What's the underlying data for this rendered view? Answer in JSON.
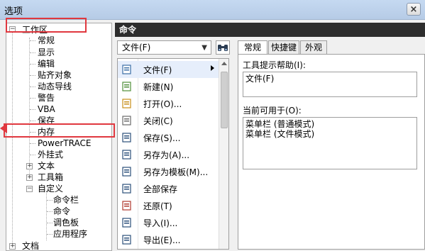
{
  "window": {
    "title": "选项",
    "close_label": "×"
  },
  "tree": {
    "items": [
      {
        "label": "工作区",
        "expander": "−"
      },
      {
        "label": "常规"
      },
      {
        "label": "显示"
      },
      {
        "label": "编辑"
      },
      {
        "label": "贴齐对象"
      },
      {
        "label": "动态导线"
      },
      {
        "label": "警告"
      },
      {
        "label": "VBA"
      },
      {
        "label": "保存"
      },
      {
        "label": "内存"
      },
      {
        "label": "PowerTRACE"
      },
      {
        "label": "外挂式"
      },
      {
        "label": "文本",
        "expander": "+"
      },
      {
        "label": "工具箱",
        "expander": "+"
      },
      {
        "label": "自定义",
        "expander": "−"
      },
      {
        "label": "命令栏"
      },
      {
        "label": "命令"
      },
      {
        "label": "调色板"
      },
      {
        "label": "应用程序"
      },
      {
        "label": "文档",
        "expander": "+"
      }
    ]
  },
  "panel": {
    "header": "命令"
  },
  "category_dropdown": {
    "value": "文件(F)"
  },
  "commands": {
    "items": [
      {
        "label": "文件(F)",
        "icon": "menu-icon",
        "has_submenu": true
      },
      {
        "label": "新建(N)",
        "icon": "new-doc-icon"
      },
      {
        "label": "打开(O)...",
        "icon": "folder-open-icon"
      },
      {
        "label": "关闭(C)",
        "icon": "close-doc-icon"
      },
      {
        "label": "保存(S)...",
        "icon": "save-icon"
      },
      {
        "label": "另存为(A)...",
        "icon": "save-as-icon"
      },
      {
        "label": "另存为模板(M)...",
        "icon": "save-template-icon"
      },
      {
        "label": "全部保存",
        "icon": "save-all-icon"
      },
      {
        "label": "还原(T)",
        "icon": "revert-icon"
      },
      {
        "label": "导入(I)...",
        "icon": "import-icon"
      },
      {
        "label": "导出(E)...",
        "icon": "export-icon"
      }
    ]
  },
  "tabs": [
    {
      "label": "常规",
      "active": true
    },
    {
      "label": "快捷键"
    },
    {
      "label": "外观"
    }
  ],
  "general_tab": {
    "tooltip_label": "工具提示帮助(I):",
    "tooltip_value": "文件(F)",
    "available_label": "当前可用于(O):",
    "available_items": [
      "菜单栏 (普通模式)",
      "菜单栏 (文件模式)"
    ]
  },
  "colors": {
    "highlight": "#e0383f",
    "header_bg": "#2d2d2d"
  }
}
